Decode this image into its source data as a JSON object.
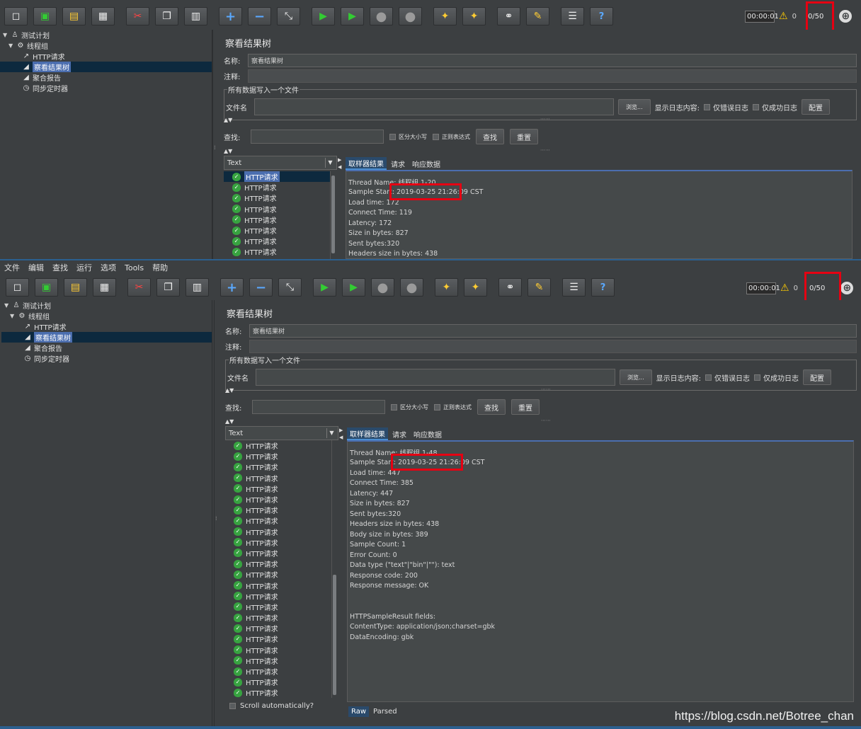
{
  "menu": [
    "文件",
    "编辑",
    "查找",
    "运行",
    "选项",
    "Tools",
    "帮助"
  ],
  "toolbar": {
    "icons": [
      "new-icon",
      "templates-icon",
      "open-icon",
      "save-icon",
      "cut-icon",
      "copy-icon",
      "paste-icon",
      "expand-icon",
      "collapse-icon",
      "toggle-icon",
      "start-icon",
      "start-no-timers-icon",
      "stop-icon",
      "shutdown-icon",
      "clear-icon",
      "clear-all-icon",
      "search-icon",
      "reset-search-icon",
      "function-helper-icon",
      "help-icon"
    ],
    "timer": "00:00:01",
    "warning_count": "0",
    "threads": "0/50"
  },
  "tree": {
    "items": [
      {
        "label": "测试计划",
        "icon": "test-plan-icon",
        "level": 0,
        "twisty": "▼"
      },
      {
        "label": "线程组",
        "icon": "thread-group-icon",
        "level": 1,
        "twisty": "▼"
      },
      {
        "label": "HTTP请求",
        "icon": "http-sampler-icon",
        "level": 2,
        "twisty": ""
      },
      {
        "label": "察看结果树",
        "icon": "listener-icon",
        "level": 2,
        "twisty": "",
        "selected": true
      },
      {
        "label": "聚合报告",
        "icon": "listener-icon",
        "level": 2,
        "twisty": ""
      },
      {
        "label": "同步定时器",
        "icon": "timer-icon",
        "level": 2,
        "twisty": ""
      }
    ]
  },
  "panel": {
    "title": "察看结果树",
    "name_label": "名称:",
    "name_value": "察看结果树",
    "comment_label": "注释:",
    "file_legend": "所有数据写入一个文件",
    "file_label": "文件名",
    "browse_label": "浏览...",
    "log_label": "显示日志内容:",
    "errors_only": "仅错误日志",
    "success_only": "仅成功日志",
    "config_label": "配置",
    "search_label": "查找:",
    "case_label": "区分大小写",
    "regex_label": "正则表达式",
    "find_button": "查找",
    "reset_button": "重置",
    "renderer": "Text",
    "tabs": [
      "取样器结果",
      "请求",
      "响应数据"
    ],
    "raw_tab": "Raw",
    "parsed_tab": "Parsed",
    "scroll_auto": "Scroll automatically?"
  },
  "results": {
    "item_label": "HTTP请求",
    "top_count": 8,
    "bottom_count": 25
  },
  "top_result": {
    "lines": [
      "Thread Name: 线程组 1-20",
      "Sample Start: 2019-03-25 21:26:09 CST",
      "Load time: 172",
      "Connect Time: 119",
      "Latency: 172",
      "Size in bytes: 827",
      "Sent bytes:320",
      "Headers size in bytes: 438"
    ]
  },
  "bottom_result": {
    "lines": [
      "Thread Name: 线程组 1-48",
      "Sample Start: 2019-03-25 21:26:09 CST",
      "Load time: 447",
      "Connect Time: 385",
      "Latency: 447",
      "Size in bytes: 827",
      "Sent bytes:320",
      "Headers size in bytes: 438",
      "Body size in bytes: 389",
      "Sample Count: 1",
      "Error Count: 0",
      "Data type (\"text\"|\"bin\"|\"\"): text",
      "Response code: 200",
      "Response message: OK",
      "",
      "",
      "HTTPSampleResult fields:",
      "ContentType: application/json;charset=gbk",
      "DataEncoding: gbk"
    ]
  },
  "watermark": "https://blog.csdn.net/Botree_chan",
  "colors": {
    "highlight": "#e60012",
    "selection": "#4b6eaf",
    "background": "#3c3f41"
  }
}
